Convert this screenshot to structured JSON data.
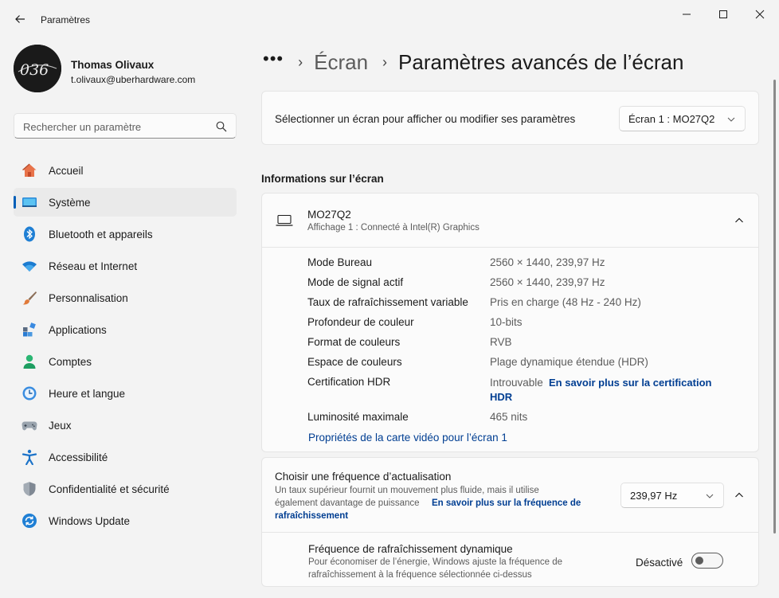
{
  "window": {
    "title": "Paramètres"
  },
  "profile": {
    "name": "Thomas Olivaux",
    "email": "t.olivaux@uberhardware.com",
    "avatar_text": "036"
  },
  "search": {
    "placeholder": "Rechercher un paramètre"
  },
  "sidebar": {
    "items": [
      {
        "label": "Accueil",
        "icon": "home-icon"
      },
      {
        "label": "Système",
        "icon": "system-icon",
        "active": true
      },
      {
        "label": "Bluetooth et appareils",
        "icon": "bluetooth-icon"
      },
      {
        "label": "Réseau et Internet",
        "icon": "wifi-icon"
      },
      {
        "label": "Personnalisation",
        "icon": "brush-icon"
      },
      {
        "label": "Applications",
        "icon": "apps-icon"
      },
      {
        "label": "Comptes",
        "icon": "account-icon"
      },
      {
        "label": "Heure et langue",
        "icon": "clock-globe-icon"
      },
      {
        "label": "Jeux",
        "icon": "gamepad-icon"
      },
      {
        "label": "Accessibilité",
        "icon": "accessibility-icon"
      },
      {
        "label": "Confidentialité et sécurité",
        "icon": "shield-icon"
      },
      {
        "label": "Windows Update",
        "icon": "update-icon"
      }
    ]
  },
  "breadcrumb": {
    "dots": "•••",
    "parent": "Écran",
    "current": "Paramètres avancés de l’écran"
  },
  "display_select": {
    "label": "Sélectionner un écran pour afficher ou modifier ses paramètres",
    "value": "Écran 1 : MO27Q2"
  },
  "info_section": {
    "heading": "Informations sur l’écran",
    "monitor_name": "MO27Q2",
    "monitor_sub": "Affichage 1 : Connecté à Intel(R) Graphics",
    "rows": [
      {
        "label": "Mode Bureau",
        "value": "2560 × 1440, 239,97 Hz"
      },
      {
        "label": "Mode de signal actif",
        "value": "2560 × 1440, 239,97 Hz"
      },
      {
        "label": "Taux de rafraîchissement variable",
        "value": "Pris en charge (48 Hz - 240 Hz)"
      },
      {
        "label": "Profondeur de couleur",
        "value": "10-bits"
      },
      {
        "label": "Format de couleurs",
        "value": "RVB"
      },
      {
        "label": "Espace de couleurs",
        "value": "Plage dynamique étendue (HDR)"
      }
    ],
    "hdr_label": "Certification HDR",
    "hdr_value": "Introuvable",
    "hdr_link_line1": "En savoir plus sur la certification",
    "hdr_link_line2": "HDR",
    "lum_label": "Luminosité maximale",
    "lum_value": "465 nits",
    "adapter_link": "Propriétés de la carte vidéo pour l’écran 1"
  },
  "refresh": {
    "title": "Choisir une fréquence d’actualisation",
    "desc_line1": "Un taux supérieur fournit un mouvement plus fluide, mais il utilise",
    "desc_line2": "également davantage de puissance",
    "link_line1": "En savoir plus sur la fréquence de",
    "link_line2": "rafraîchissement",
    "value": "239,97 Hz"
  },
  "dynamic_refresh": {
    "title": "Fréquence de rafraîchissement dynamique",
    "desc_line1": "Pour économiser de l’énergie, Windows ajuste la fréquence de",
    "desc_line2": "rafraîchissement à la fréquence sélectionnée ci-dessus",
    "state": "Désactivé"
  },
  "colors": {
    "accent": "#005fb8",
    "link": "#003e92"
  }
}
